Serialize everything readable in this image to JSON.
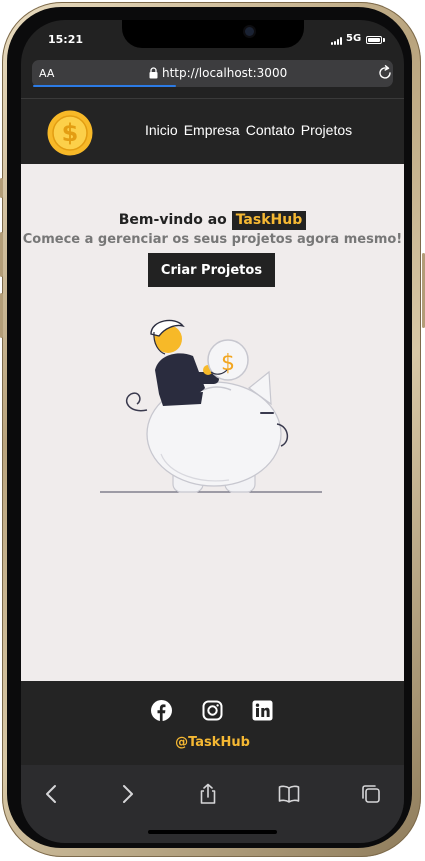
{
  "status": {
    "time": "15:21",
    "network": "5G"
  },
  "browser": {
    "text_size_label": "AA",
    "url": "http://localhost:3000"
  },
  "nav": {
    "items": [
      {
        "label": "Inicio"
      },
      {
        "label": "Empresa"
      },
      {
        "label": "Contato"
      },
      {
        "label": "Projetos"
      }
    ]
  },
  "hero": {
    "welcome": "Bem-vindo ao",
    "brand": "TaskHub",
    "subtitle": "Comece a gerenciar os seus projetos agora mesmo!",
    "cta_label": "Criar Projetos"
  },
  "footer": {
    "social": [
      "facebook-icon",
      "instagram-icon",
      "linkedin-icon"
    ],
    "handle": "@TaskHub"
  },
  "colors": {
    "accent": "#f5b833",
    "dark": "#242424",
    "page_bg": "#f0ecec",
    "muted_text": "#777777",
    "progress": "#2c7be5"
  }
}
